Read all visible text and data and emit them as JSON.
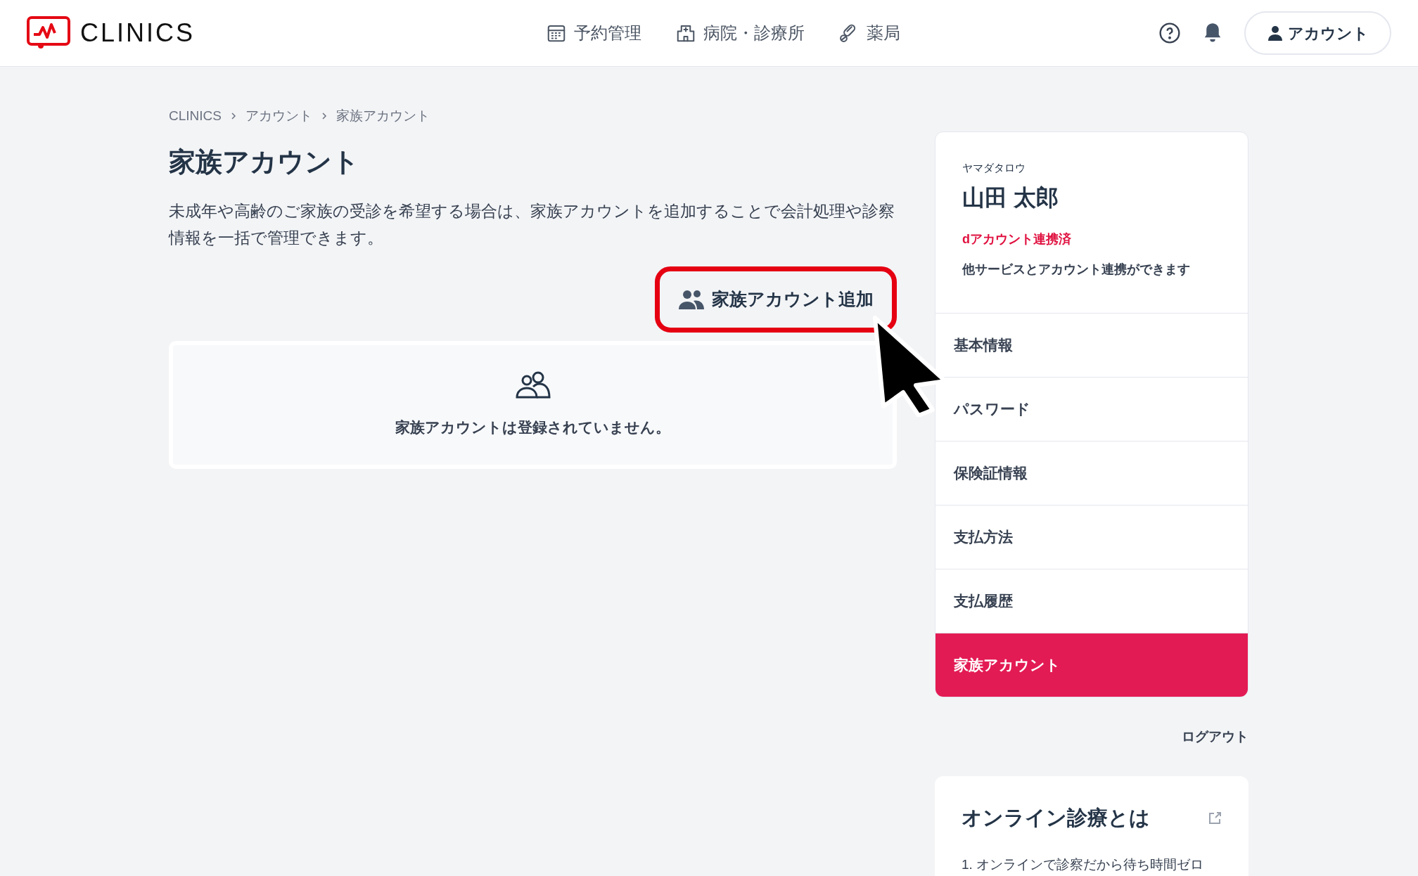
{
  "header": {
    "logo_text": "CLINICS",
    "nav": [
      {
        "label": "予約管理",
        "kind": "calendar"
      },
      {
        "label": "病院・診療所",
        "kind": "hospital"
      },
      {
        "label": "薬局",
        "kind": "pill"
      }
    ],
    "account_button": "アカウント"
  },
  "breadcrumb": [
    "CLINICS",
    "アカウント",
    "家族アカウント"
  ],
  "page": {
    "title": "家族アカウント",
    "description": "未成年や高齢のご家族の受診を希望する場合は、家族アカウントを追加することで会計処理や診察情報を一括で管理できます。",
    "add_button": {
      "label": "家族アカウント追加",
      "highlighted": true
    },
    "empty_message": "家族アカウントは登録されていません。"
  },
  "profile": {
    "kana": "ヤマダタロウ",
    "name": "山田 太郎",
    "link_status": "dアカウント連携済",
    "link_note": "他サービスとアカウント連携ができます"
  },
  "menu": [
    {
      "label": "基本情報",
      "selected": false
    },
    {
      "label": "パスワード",
      "selected": false
    },
    {
      "label": "保険証情報",
      "selected": false
    },
    {
      "label": "支払方法",
      "selected": false
    },
    {
      "label": "支払履歴",
      "selected": false
    },
    {
      "label": "家族アカウント",
      "selected": true
    }
  ],
  "logout": "ログアウト",
  "info_card": {
    "title": "オンライン診療とは",
    "items": [
      "1. オンラインで診察だから待ち時間ゼロ"
    ]
  }
}
